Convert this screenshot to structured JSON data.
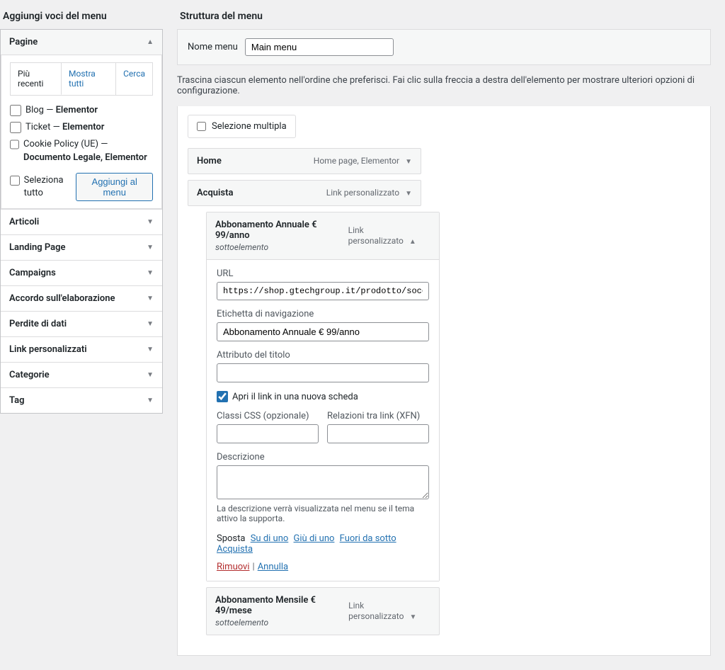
{
  "left": {
    "title": "Aggiungi voci del menu",
    "pagine": {
      "label": "Pagine",
      "tabs": {
        "recenti": "Più recenti",
        "tutti": "Mostra tutti",
        "cerca": "Cerca"
      },
      "items": [
        {
          "name": "Blog",
          "sep": " — ",
          "type": "Elementor"
        },
        {
          "name": "Ticket",
          "sep": " — ",
          "type": "Elementor"
        },
        {
          "name": "Cookie Policy (UE)",
          "sep": " — ",
          "type": "Documento Legale, Elementor"
        }
      ],
      "select_all": "Seleziona tutto",
      "add": "Aggiungi al menu"
    },
    "sections": [
      "Articoli",
      "Landing Page",
      "Campaigns",
      "Accordo sull'elaborazione",
      "Perdite di dati",
      "Link personalizzati",
      "Categorie",
      "Tag"
    ]
  },
  "right": {
    "title": "Struttura del menu",
    "name_label": "Nome menu",
    "name_value": "Main menu",
    "instructions": "Trascina ciascun elemento nell'ordine che preferisci. Fai clic sulla freccia a destra dell'elemento per mostrare ulteriori opzioni di configurazione.",
    "bulk_select": "Selezione multipla",
    "items": {
      "home": {
        "title": "Home",
        "type": "Home page, Elementor"
      },
      "acquista": {
        "title": "Acquista",
        "type": "Link personalizzato"
      },
      "annuale_head": {
        "title": "Abbonamento Annuale € 99/anno",
        "type": "Link personalizzato",
        "sub": "sottoelemento"
      },
      "mensile": {
        "title": "Abbonamento Mensile € 49/mese",
        "type": "Link personalizzato",
        "sub": "sottoelemento"
      }
    },
    "form": {
      "url_label": "URL",
      "url_value": "https://shop.gtechgroup.it/prodotto/soccorsowp-it",
      "nav_label": "Etichetta di navigazione",
      "nav_value": "Abbonamento Annuale € 99/anno",
      "title_attr": "Attributo del titolo",
      "newtab": "Apri il link in una nuova scheda",
      "css_label": "Classi CSS (opzionale)",
      "xfn_label": "Relazioni tra link (XFN)",
      "desc_label": "Descrizione",
      "desc_hint": "La descrizione verrà visualizzata nel menu se il tema attivo la supporta.",
      "move_label": "Sposta",
      "move_up": "Su di uno",
      "move_down": "Giù di uno",
      "move_out": "Fuori da sotto Acquista",
      "remove": "Rimuovi",
      "cancel": "Annulla"
    }
  }
}
